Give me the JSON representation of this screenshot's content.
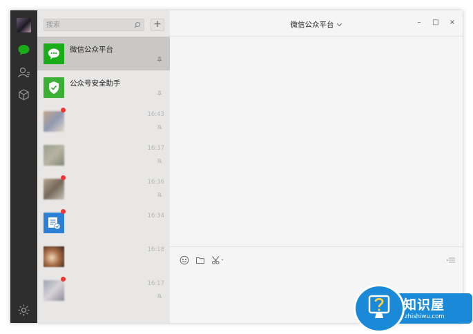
{
  "search": {
    "placeholder": "搜索"
  },
  "list_actions": {
    "add": "+"
  },
  "chats": [
    {
      "name": "微信公众平台",
      "time": "",
      "avatar": "wechat-logo-icon",
      "selected": true,
      "pinned": true,
      "unread": false
    },
    {
      "name": "公众号安全助手",
      "time": "",
      "avatar": "shield-check-icon",
      "selected": false,
      "pinned": true,
      "unread": false
    },
    {
      "name": "",
      "time": "16:43",
      "avatar": "blurred-photo",
      "selected": false,
      "muted": true,
      "unread": true
    },
    {
      "name": "",
      "time": "16:37",
      "avatar": "blurred-photo",
      "selected": false,
      "muted": true,
      "unread": false
    },
    {
      "name": "",
      "time": "16:36",
      "avatar": "blurred-photo",
      "selected": false,
      "muted": true,
      "unread": true
    },
    {
      "name": "",
      "time": "16:34",
      "avatar": "document-check-icon",
      "selected": false,
      "muted": false,
      "unread": true
    },
    {
      "name": "",
      "time": "16:18",
      "avatar": "blurred-photo",
      "selected": false,
      "muted": false,
      "unread": false
    },
    {
      "name": "",
      "time": "16:17",
      "avatar": "blurred-photo",
      "selected": false,
      "muted": true,
      "unread": true
    }
  ],
  "chat": {
    "title": "微信公众平台"
  },
  "window_controls": {
    "minimize": "–",
    "maximize": "□",
    "close": "×"
  },
  "watermark": {
    "title": "知识屋",
    "subtitle": "zhishiwu.com"
  },
  "colors": {
    "rail": "#2e2e2e",
    "list": "#e8e7e6",
    "selected": "#c9c8c6",
    "wechat_green": "#1aad19",
    "unread": "#f43530",
    "watermark_blue": "#1a8ad8"
  }
}
